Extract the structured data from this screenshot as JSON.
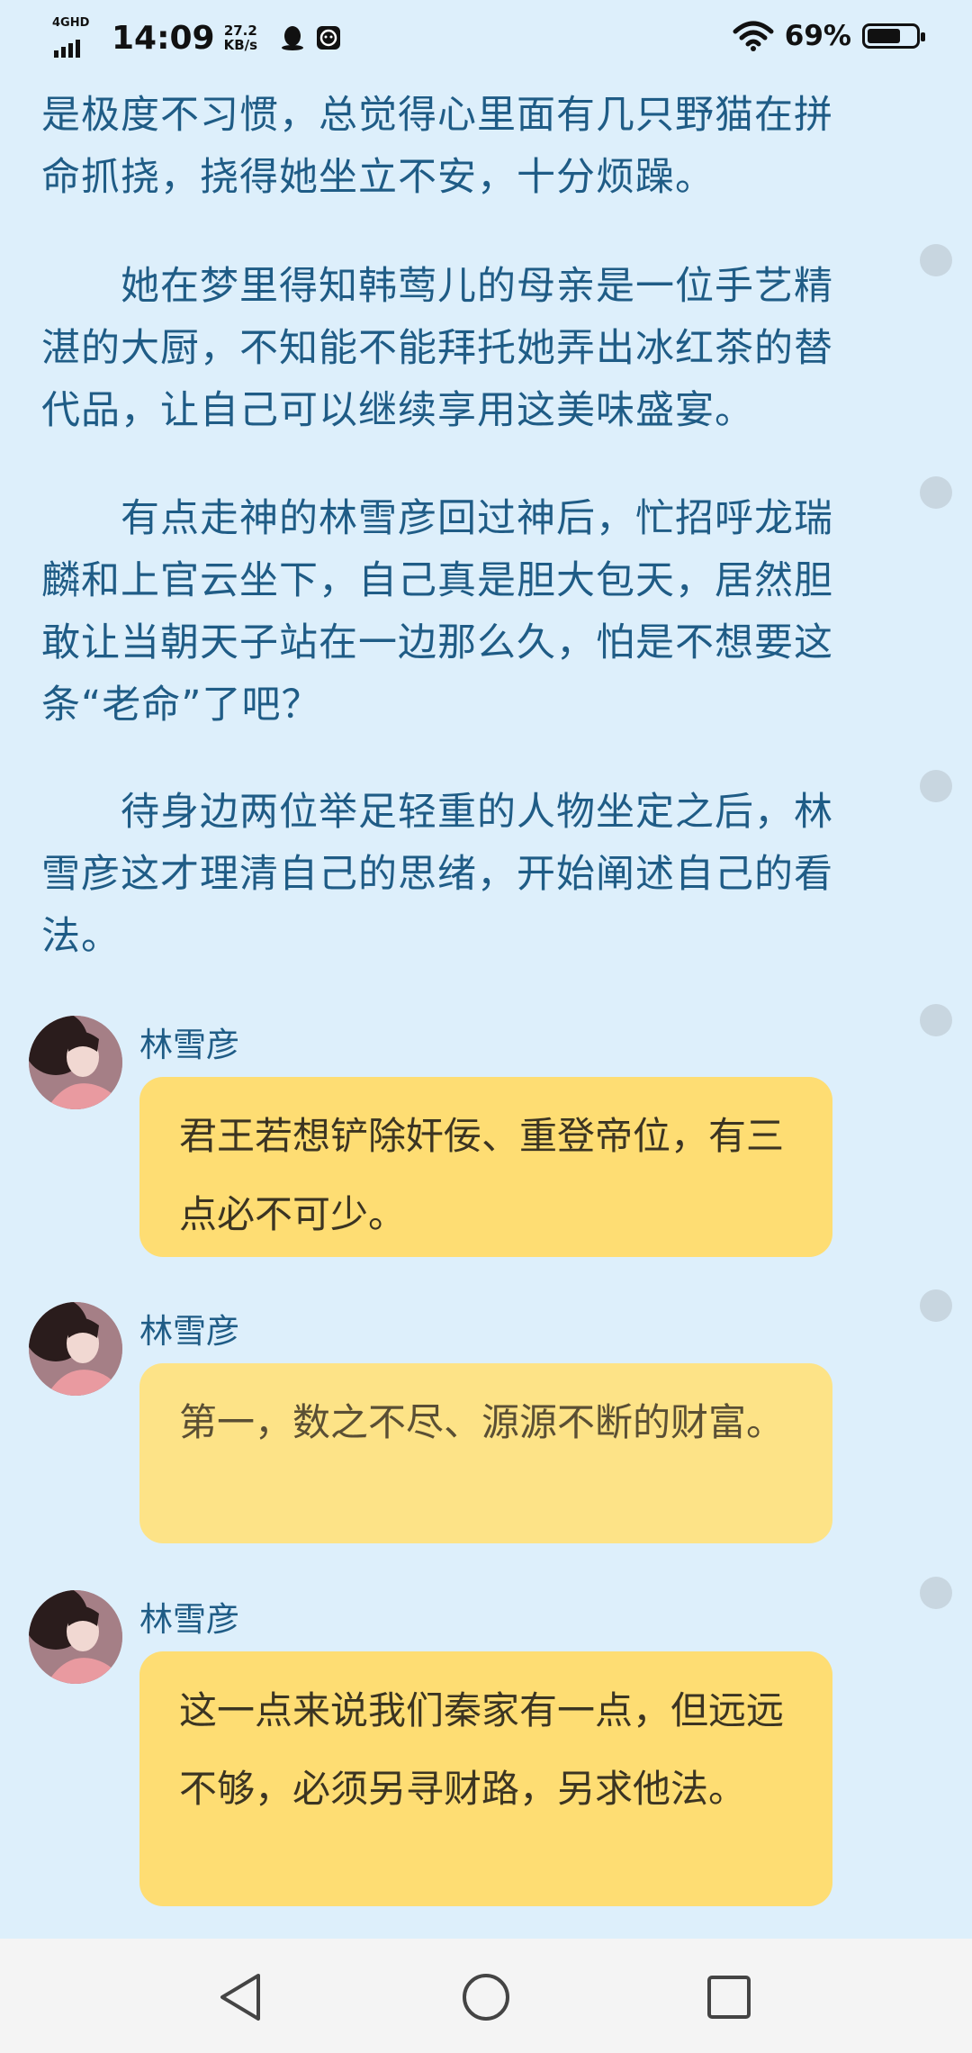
{
  "status_bar": {
    "network": "4GHD",
    "time": "14:09",
    "speed_value": "27.2",
    "speed_unit": "KB/s",
    "battery_percent": "69%",
    "battery_level": 0.69,
    "icons": [
      "signal-icon",
      "qq-icon",
      "sticker-icon",
      "wifi-icon",
      "battery-icon"
    ]
  },
  "story": {
    "paragraphs": [
      "是极度不习惯，总觉得心里面有几只野猫在拼命抓挠，挠得她坐立不安，十分烦躁。",
      "她在梦里得知韩莺儿的母亲是一位手艺精湛的大厨，不知能不能拜托她弄出冰红茶的替代品，让自己可以继续享用这美味盛宴。",
      "有点走神的林雪彦回过神后，忙招呼龙瑞麟和上官云坐下，自己真是胆大包天，居然胆敢让当朝天子站在一边那么久，怕是不想要这条“老命”了吧？",
      "待身边两位举足轻重的人物坐定之后，林雪彦这才理清自己的思绪，开始阐述自己的看法。"
    ]
  },
  "chat": {
    "messages": [
      {
        "speaker": "林雪彦",
        "text": "君王若想铲除奸佞、重登帝位，有三点必不可少。"
      },
      {
        "speaker": "林雪彦",
        "text": "第一，数之不尽、源源不断的财富。"
      },
      {
        "speaker": "林雪彦",
        "text": "这一点来说我们秦家有一点，但远远不够，必须另寻财路，另求他法。"
      }
    ]
  },
  "nav_bar": {
    "icons": [
      "back-icon",
      "home-icon",
      "recents-icon"
    ]
  },
  "colors": {
    "background": "#ddeffb",
    "text": "#1f5c86",
    "bubble": "#fedd73",
    "nav_bar": "#f4f4f4"
  }
}
